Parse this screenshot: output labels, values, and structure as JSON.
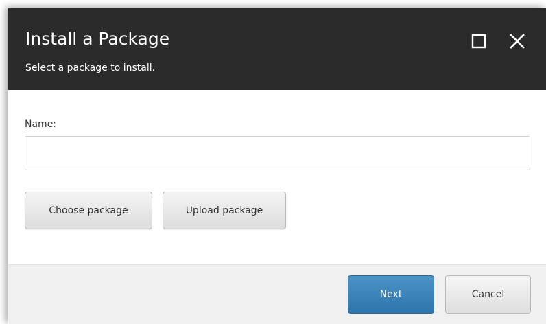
{
  "dialog": {
    "title": "Install a Package",
    "subtitle": "Select a package to install."
  },
  "form": {
    "name_label": "Name:",
    "name_value": "",
    "name_placeholder": ""
  },
  "actions": {
    "choose_label": "Choose package",
    "upload_label": "Upload package"
  },
  "footer": {
    "next_label": "Next",
    "cancel_label": "Cancel"
  },
  "icons": {
    "maximize": "maximize-icon",
    "close": "close-icon"
  },
  "colors": {
    "header_bg": "#2b2b2b",
    "primary": "#3a84ba",
    "footer_bg": "#f0f0f0"
  }
}
